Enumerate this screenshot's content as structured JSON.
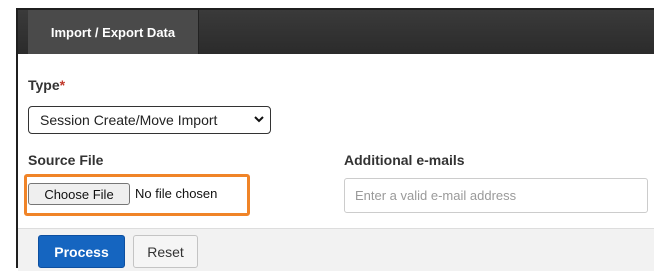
{
  "header": {
    "tab_label": "Import / Export Data"
  },
  "form": {
    "type_label": "Type",
    "required_mark": "*",
    "type_selected": "Session Create/Move Import",
    "source_file_label": "Source File",
    "choose_file_label": "Choose File",
    "no_file_text": "No file chosen",
    "emails_label": "Additional e-mails",
    "emails_placeholder": "Enter a valid e-mail address",
    "emails_value": ""
  },
  "actions": {
    "process_label": "Process",
    "reset_label": "Reset"
  },
  "colors": {
    "header_bg": "#2b2b2b",
    "primary_button": "#1565c0",
    "highlight_outline": "#f08428",
    "required_mark": "#c0392b"
  },
  "icons": {
    "select_arrow": "chevron-down-icon"
  }
}
